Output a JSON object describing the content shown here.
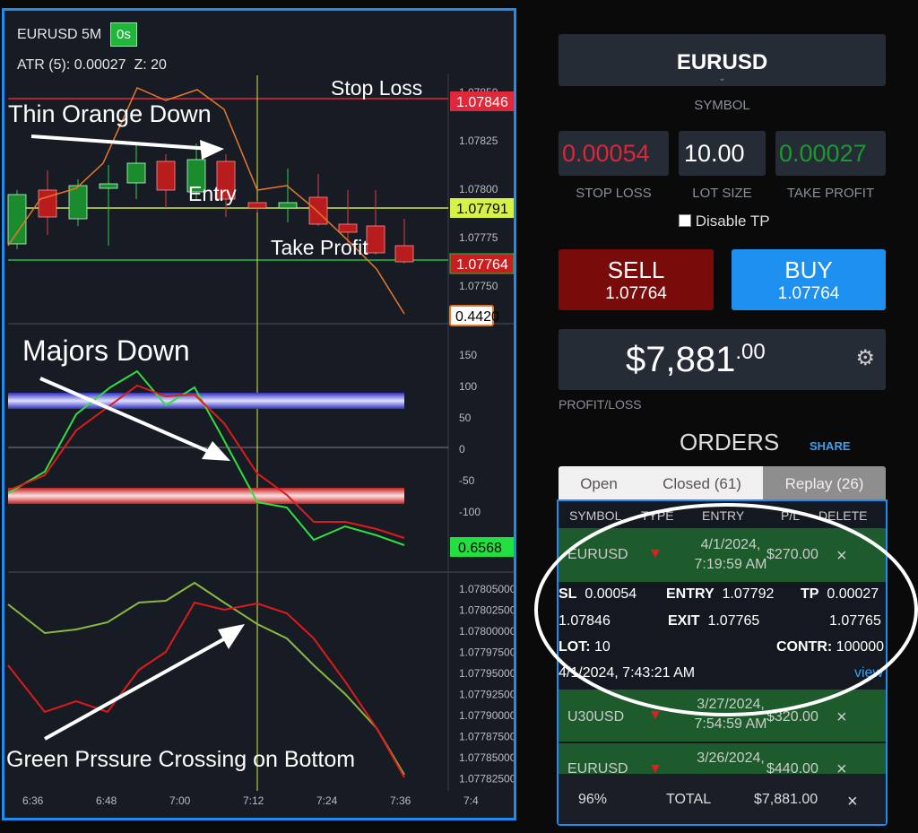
{
  "header": {
    "symbol_tf": "EURUSD 5M",
    "timer": "0s",
    "atr_label": "ATR (5):",
    "atr_value": "0.00027",
    "z_label": "Z:",
    "z_value": "20"
  },
  "price_pane": {
    "y_ticks": [
      "1.07850",
      "1.07825",
      "1.07800",
      "1.07775",
      "1.07750"
    ],
    "stop_loss_tag": "1.07846",
    "entry_tag": "1.07791",
    "take_profit_tag": "1.07764",
    "indicator_tag": "0.4420",
    "annotations": {
      "thin_orange": "Thin Orange Down",
      "stop_loss": "Stop Loss",
      "entry": "Entry",
      "take_profit": "Take Profit"
    }
  },
  "majors_pane": {
    "y_ticks": [
      "150",
      "100",
      "50",
      "0",
      "-50",
      "-100"
    ],
    "value_tag": "0.6568",
    "annotation": "Majors Down"
  },
  "pressure_pane": {
    "y_ticks": [
      "1.07805000",
      "1.07802500",
      "1.07800000",
      "1.07797500",
      "1.07795000",
      "1.07792500",
      "1.07790000",
      "1.07787500",
      "1.07785000",
      "1.07782500"
    ],
    "annotation": "Green Prssure Crossing on Bottom"
  },
  "x_axis": {
    "ticks": [
      "6:36",
      "6:48",
      "7:00",
      "7:12",
      "7:24",
      "7:36",
      "7:4"
    ]
  },
  "colors": {
    "bull": "#1a8c2e",
    "bear": "#b81c1c",
    "stop": "#e0283a",
    "entry": "#d4e84a",
    "tp": "#20c040",
    "orange": "#e8782a",
    "panel_border": "#1e8cf0",
    "buy": "#1e90f0",
    "sell": "#7a0b0b"
  },
  "ticket": {
    "symbol": "EURUSD",
    "symbol_caption": "SYMBOL",
    "stop_loss": "0.00054",
    "stop_loss_caption": "STOP LOSS",
    "lot_size": "10.00",
    "lot_size_caption": "LOT SIZE",
    "take_profit": "0.00027",
    "take_profit_caption": "TAKE PROFIT",
    "disable_tp": "Disable TP",
    "sell_label": "SELL",
    "sell_price": "1.07764",
    "buy_label": "BUY",
    "buy_price": "1.07764",
    "pl_main": "$7,881",
    "pl_cents": ".00",
    "pl_caption": "PROFIT/LOSS"
  },
  "orders": {
    "title": "ORDERS",
    "share": "SHARE",
    "tabs": [
      "Open",
      "Closed (61)",
      "Replay (26)"
    ],
    "columns": [
      "SYMBOL",
      "TYPE",
      "ENTRY",
      "P/L",
      "DELETE"
    ],
    "rows": [
      {
        "symbol": "EURUSD",
        "date": "4/1/2024,",
        "time": "7:19:59 AM",
        "pl": "$270.00"
      },
      {
        "symbol": "U30USD",
        "date": "3/27/2024,",
        "time": "7:54:59 AM",
        "pl": "$320.00"
      },
      {
        "symbol": "EURUSD",
        "date": "3/26/2024,",
        "time": "",
        "pl": "$440.00"
      }
    ],
    "detail": {
      "sl_label": "SL",
      "sl_value": "0.00054",
      "entry_label": "ENTRY",
      "entry_value": "1.07792",
      "tp_label": "TP",
      "tp_value": "0.00027",
      "sl_price": "1.07846",
      "exit_label": "EXIT",
      "exit_value": "1.07765",
      "tp_price": "1.07765",
      "lot_label": "LOT:",
      "lot_value": "10",
      "contr_label": "CONTR:",
      "contr_value": "100000",
      "closed_at": "4/1/2024, 7:43:21 AM",
      "view": "view"
    },
    "footer": {
      "percent": "96%",
      "total_label": "TOTAL",
      "total_value": "$7,881.00"
    }
  }
}
